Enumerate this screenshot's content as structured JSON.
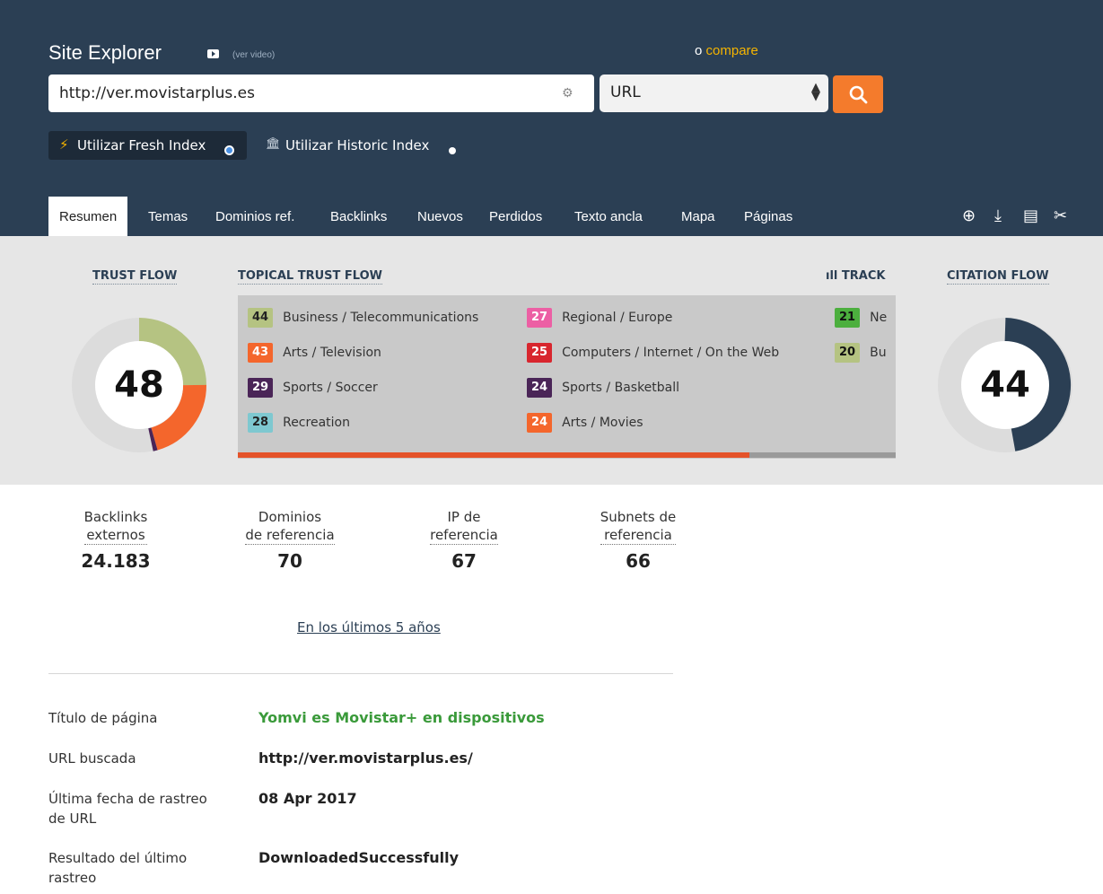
{
  "header": {
    "title": "Site Explorer",
    "video_link": "(ver video)",
    "compare_prefix": "o",
    "compare_link": "compare",
    "url_value": "http://ver.movistarplus.es",
    "type_value": "URL",
    "fresh_index_label": "Utilizar Fresh Index",
    "historic_index_label": "Utilizar Historic Index"
  },
  "tabs": [
    {
      "label": "Resumen",
      "active": true
    },
    {
      "label": "Temas"
    },
    {
      "label": "Dominios ref."
    },
    {
      "label": "Backlinks"
    },
    {
      "label": "Nuevos"
    },
    {
      "label": "Perdidos"
    },
    {
      "label": "Texto ancla"
    },
    {
      "label": "Mapa"
    },
    {
      "label": "Páginas"
    }
  ],
  "tools": [
    "add-icon",
    "download-icon",
    "report-icon",
    "settings-icon"
  ],
  "summary": {
    "trust_flow": {
      "title": "TRUST FLOW",
      "value": "48"
    },
    "topical_title": "TOPICAL TRUST FLOW",
    "track_title": "TRACK",
    "citation_flow": {
      "title": "CITATION FLOW",
      "value": "44"
    },
    "topics": [
      {
        "score": "44",
        "label": "Business / Telecommunications",
        "color": "#b5c382"
      },
      {
        "score": "43",
        "label": "Arts / Television",
        "color": "#f4662c"
      },
      {
        "score": "29",
        "label": "Sports / Soccer",
        "color": "#4a2557"
      },
      {
        "score": "28",
        "label": "Recreation",
        "color": "#7ec8d0"
      },
      {
        "score": "27",
        "label": "Regional / Europe",
        "color": "#ec5fa4"
      },
      {
        "score": "25",
        "label": "Computers / Internet / On the Web",
        "color": "#d8262e"
      },
      {
        "score": "24",
        "label": "Sports / Basketball",
        "color": "#4a2557"
      },
      {
        "score": "24",
        "label": "Arts / Movies",
        "color": "#f4662c"
      },
      {
        "score": "21",
        "label": "Ne",
        "color": "#4caf3e"
      },
      {
        "score": "20",
        "label": "Bu",
        "color": "#b5c382"
      }
    ]
  },
  "stats": [
    {
      "label_1": "Backlinks",
      "label_2": "externos",
      "value": "24.183"
    },
    {
      "label_1": "Dominios",
      "label_2": "de referencia",
      "value": "70"
    },
    {
      "label_1": "IP de",
      "label_2": "referencia",
      "value": "67"
    },
    {
      "label_1": "Subnets de",
      "label_2": "referencia",
      "value": "66"
    }
  ],
  "period_link": "En los últimos 5 años",
  "info": [
    {
      "label": "Título de página",
      "value": "Yomvi es Movistar+ en dispositivos"
    },
    {
      "label": "URL buscada",
      "value": "http://ver.movistarplus.es/"
    },
    {
      "label": "Última fecha de rastreo de URL",
      "value": "08 Apr 2017"
    },
    {
      "label": "Resultado del último rastreo",
      "value": "DownloadedSuccessfully"
    }
  ]
}
